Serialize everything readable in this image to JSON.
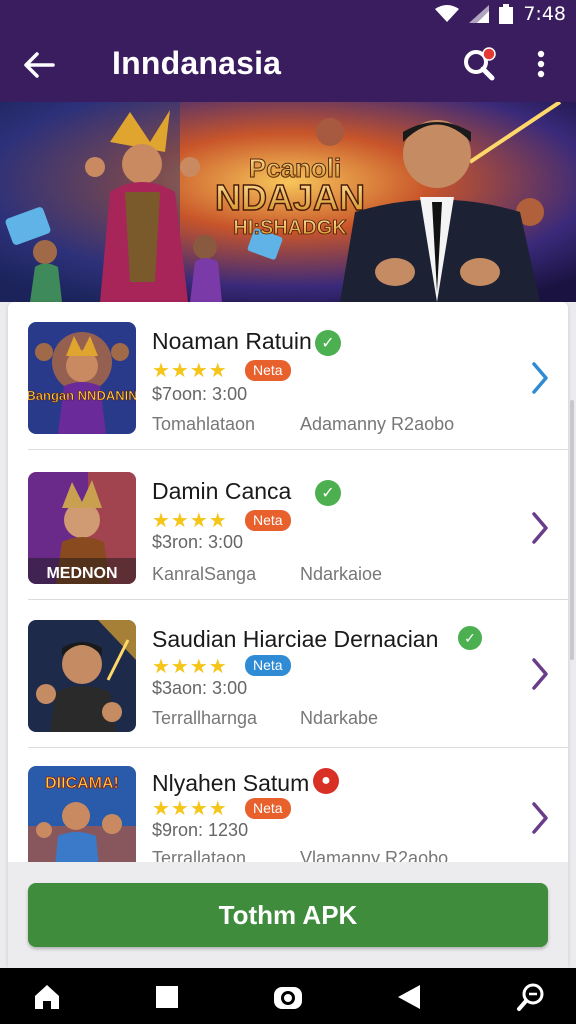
{
  "status_bar": {
    "time": "7:48",
    "icons": [
      "wifi-icon",
      "signal-icon",
      "battery-icon"
    ]
  },
  "app_bar": {
    "title": "Inndanasia",
    "icons": [
      "back-arrow-icon",
      "search-icon",
      "more-vert-icon"
    ]
  },
  "banner": {
    "line1": "Pcanoli",
    "line2": "NDAJAN",
    "line3": "HI:SHADGK"
  },
  "apps": [
    {
      "name": "Noaman Ratuin",
      "badge": "Neta",
      "badge_color": "#e8602c",
      "price_time": "$7oon: 3:00",
      "developer": "Tomahlataon",
      "publisher": "Adamanny R2aobo",
      "thumb_text": "Bangan NNDANIN",
      "verified_color": "#4caf50",
      "chevron_color": "#2f8bd3"
    },
    {
      "name": "Damin Canca",
      "badge": "Neta",
      "badge_color": "#e8602c",
      "price_time": "$3ron: 3:00",
      "developer": "KanralSanga",
      "publisher": "Ndarkaioe",
      "thumb_text": "MEDNON",
      "verified_color": "#4caf50",
      "chevron_color": "#6a3d8a"
    },
    {
      "name": "Saudian Hiarciae Dernacian",
      "badge": "Neta",
      "badge_color": "#2f8bd3",
      "price_time": "$3aon: 3:00",
      "developer": "Terrallharnga",
      "publisher": "Ndarkabe",
      "thumb_text": "",
      "verified_color": "#4caf50",
      "chevron_color": "#6a3d8a"
    },
    {
      "name": "Nlyahen Satum",
      "badge": "Neta",
      "badge_color": "#e8602c",
      "price_time": "$9ron: 1230",
      "developer": "Terrallataon",
      "publisher": "Vlamanny R2aobo",
      "thumb_text": "DIICAMA!",
      "verified_color": "#d93025",
      "chevron_color": "#6a3d8a"
    }
  ],
  "install_button": {
    "label": "Tothm APK"
  },
  "nav_bar": {
    "icons": [
      "home-icon",
      "stop-icon",
      "camera-icon",
      "back-triangle-icon",
      "search-nav-icon"
    ]
  }
}
